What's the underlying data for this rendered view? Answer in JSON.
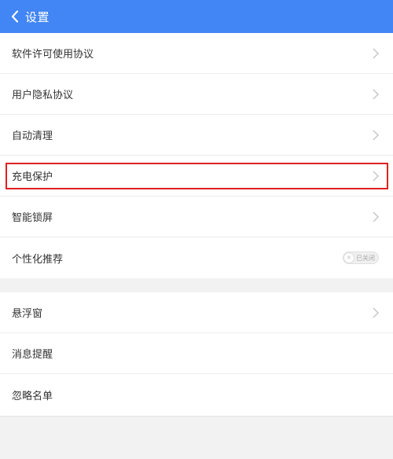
{
  "header": {
    "back_icon": "chevron-left-icon",
    "title": "设置"
  },
  "group1": {
    "items": [
      {
        "label": "软件许可使用协议",
        "icon": "chevron-right-icon"
      },
      {
        "label": "用户隐私协议",
        "icon": "chevron-right-icon"
      },
      {
        "label": "自动清理",
        "icon": "chevron-right-icon"
      },
      {
        "label": "充电保护",
        "icon": "chevron-right-icon",
        "highlighted": true
      },
      {
        "label": "智能锁屏",
        "icon": "chevron-right-icon"
      },
      {
        "label": "个性化推荐",
        "toggle": {
          "state": "off",
          "text": "已关闭",
          "knob": "×"
        }
      }
    ]
  },
  "group2": {
    "items": [
      {
        "label": "悬浮窗",
        "icon": "chevron-right-icon"
      },
      {
        "label": "消息提醒"
      },
      {
        "label": "忽略名单"
      }
    ]
  },
  "colors": {
    "header_bg": "#4285f4",
    "highlight_border": "#e02020",
    "page_bg": "#f2f2f2"
  }
}
